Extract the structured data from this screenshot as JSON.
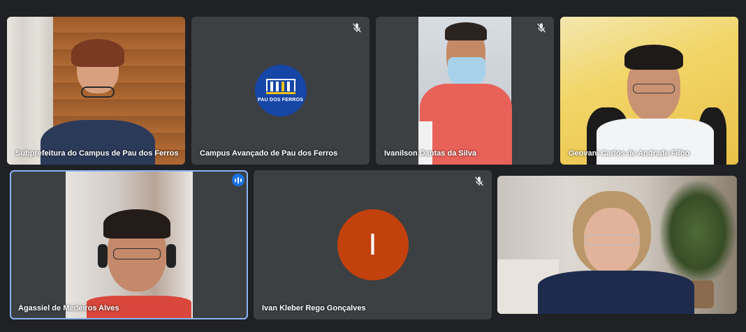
{
  "meeting": {
    "participants": [
      {
        "name": "Subprefeitura do Campus de Pau dos Ferros",
        "muted": false,
        "video": true
      },
      {
        "name": "Campus Avançado de Pau dos Ferros",
        "muted": true,
        "video": false,
        "avatar_logo_text": "PAU DOS FERROS"
      },
      {
        "name": "Ivanilson Dantas da Silva",
        "muted": true,
        "video": true
      },
      {
        "name": "Geovani Carlos de Andrade Filho",
        "muted": false,
        "video": true
      },
      {
        "name": "Agassiel de Medeiros Alves",
        "muted": false,
        "video": true,
        "speaking": true
      },
      {
        "name": "Ivan Kleber Rego Gonçalves",
        "muted": true,
        "video": false,
        "avatar_initial": "I"
      },
      {
        "name": "",
        "muted": false,
        "video": true
      }
    ]
  },
  "colors": {
    "background": "#202124",
    "tile": "#3c4043",
    "active_border": "#8ab4f8",
    "speaking_badge": "#1a73e8",
    "initial_avatar": "#c2410c",
    "logo_avatar": "#1646a6"
  },
  "icons": {
    "mute": "microphone-off-icon",
    "speaking": "audio-level-icon"
  }
}
